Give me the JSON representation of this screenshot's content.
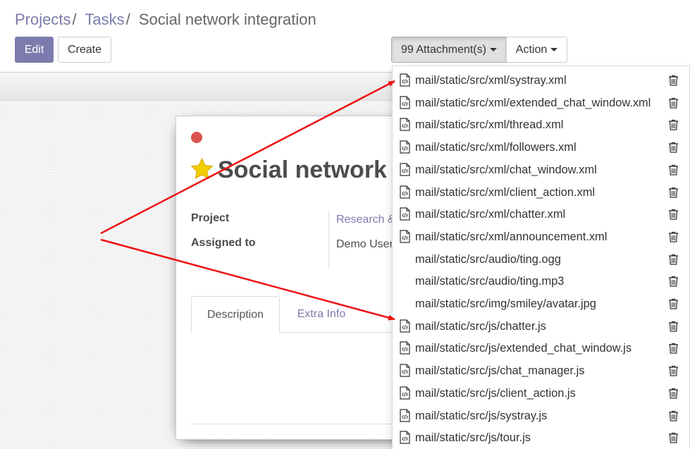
{
  "breadcrumb": {
    "projects": "Projects",
    "tasks": "Tasks",
    "current": "Social network integration",
    "separator": "/"
  },
  "buttons": {
    "edit": "Edit",
    "create": "Create",
    "attachments": "99 Attachment(s)",
    "action": "Action"
  },
  "task": {
    "title": "Social network",
    "fields": {
      "project_label": "Project",
      "project_value": "Research &",
      "assigned_label": "Assigned to",
      "assigned_value": "Demo User"
    },
    "tabs": {
      "description": "Description",
      "extra_info": "Extra Info"
    }
  },
  "attachments": [
    {
      "name": "mail/static/src/xml/systray.xml",
      "icon": "file-code-icon"
    },
    {
      "name": "mail/static/src/xml/extended_chat_window.xml",
      "icon": "file-code-icon"
    },
    {
      "name": "mail/static/src/xml/thread.xml",
      "icon": "file-code-icon"
    },
    {
      "name": "mail/static/src/xml/followers.xml",
      "icon": "file-code-icon"
    },
    {
      "name": "mail/static/src/xml/chat_window.xml",
      "icon": "file-code-icon"
    },
    {
      "name": "mail/static/src/xml/client_action.xml",
      "icon": "file-code-icon"
    },
    {
      "name": "mail/static/src/xml/chatter.xml",
      "icon": "file-code-icon"
    },
    {
      "name": "mail/static/src/xml/announcement.xml",
      "icon": "file-code-icon"
    },
    {
      "name": "mail/static/src/audio/ting.ogg",
      "icon": ""
    },
    {
      "name": "mail/static/src/audio/ting.mp3",
      "icon": ""
    },
    {
      "name": "mail/static/src/img/smiley/avatar.jpg",
      "icon": ""
    },
    {
      "name": "mail/static/src/js/chatter.js",
      "icon": "file-code-icon"
    },
    {
      "name": "mail/static/src/js/extended_chat_window.js",
      "icon": "file-code-icon"
    },
    {
      "name": "mail/static/src/js/chat_manager.js",
      "icon": "file-code-icon"
    },
    {
      "name": "mail/static/src/js/client_action.js",
      "icon": "file-code-icon"
    },
    {
      "name": "mail/static/src/js/systray.js",
      "icon": "file-code-icon"
    },
    {
      "name": "mail/static/src/js/tour.js",
      "icon": "file-code-icon"
    }
  ],
  "colors": {
    "primary": "#7c7bad",
    "arrow": "#ee1111",
    "kanban_state": "#d9534f",
    "star": "#f3cc00"
  }
}
